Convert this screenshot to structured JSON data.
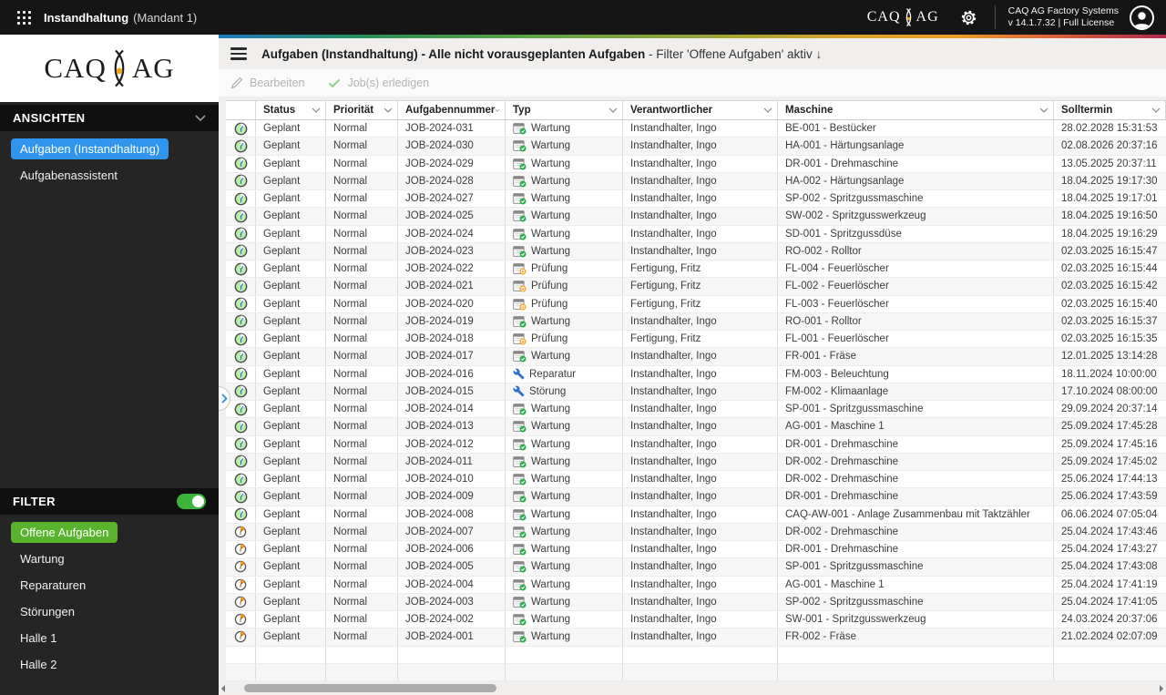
{
  "topbar": {
    "app_title": "Instandhaltung",
    "tenant": "(Mandant 1)",
    "brand_left": "CAQ",
    "brand_right": "AG",
    "product_name": "CAQ AG Factory Systems",
    "version_line": "v 14.1.7.32  |  Full License"
  },
  "sidebar": {
    "views_header": "ANSICHTEN",
    "views": [
      {
        "label": "Aufgaben (Instandhaltung)",
        "selected": true
      },
      {
        "label": "Aufgabenassistent",
        "selected": false
      }
    ],
    "filter_header": "FILTER",
    "filter_toggle_on": true,
    "filters": [
      {
        "label": "Offene Aufgaben",
        "selected": true
      },
      {
        "label": "Wartung",
        "selected": false
      },
      {
        "label": "Reparaturen",
        "selected": false
      },
      {
        "label": "Störungen",
        "selected": false
      },
      {
        "label": "Halle 1",
        "selected": false
      },
      {
        "label": "Halle 2",
        "selected": false
      }
    ]
  },
  "main": {
    "title_bold": "Aufgaben (Instandhaltung) - Alle nicht vorausgeplanten Aufgaben",
    "title_suffix": " - Filter 'Offene Aufgaben' aktiv ↓",
    "toolbar": {
      "edit_label": "Bearbeiten",
      "complete_label": "Job(s) erledigen"
    }
  },
  "table": {
    "columns": [
      "Status",
      "Priorität",
      "Aufgabennummer",
      "Typ",
      "Verantwortlicher",
      "Maschine",
      "Solltermin"
    ],
    "rows": [
      {
        "status_icon": "clock-green",
        "status": "Geplant",
        "priority": "Normal",
        "job": "JOB-2024-031",
        "type_icon": "wartung",
        "type": "Wartung",
        "responsible": "Instandhalter, Ingo",
        "machine": "BE-001 - Bestücker",
        "due": "28.02.2028 15:31:53"
      },
      {
        "status_icon": "clock-green",
        "status": "Geplant",
        "priority": "Normal",
        "job": "JOB-2024-030",
        "type_icon": "wartung",
        "type": "Wartung",
        "responsible": "Instandhalter, Ingo",
        "machine": "HA-001 - Härtungsanlage",
        "due": "02.08.2026 20:37:16"
      },
      {
        "status_icon": "clock-green",
        "status": "Geplant",
        "priority": "Normal",
        "job": "JOB-2024-029",
        "type_icon": "wartung",
        "type": "Wartung",
        "responsible": "Instandhalter, Ingo",
        "machine": "DR-001 - Drehmaschine",
        "due": "13.05.2025 20:37:11"
      },
      {
        "status_icon": "clock-green",
        "status": "Geplant",
        "priority": "Normal",
        "job": "JOB-2024-028",
        "type_icon": "wartung",
        "type": "Wartung",
        "responsible": "Instandhalter, Ingo",
        "machine": "HA-002 - Härtungsanlage",
        "due": "18.04.2025 19:17:30"
      },
      {
        "status_icon": "clock-green",
        "status": "Geplant",
        "priority": "Normal",
        "job": "JOB-2024-027",
        "type_icon": "wartung",
        "type": "Wartung",
        "responsible": "Instandhalter, Ingo",
        "machine": "SP-002 - Spritzgussmaschine",
        "due": "18.04.2025 19:17:01"
      },
      {
        "status_icon": "clock-green",
        "status": "Geplant",
        "priority": "Normal",
        "job": "JOB-2024-025",
        "type_icon": "wartung",
        "type": "Wartung",
        "responsible": "Instandhalter, Ingo",
        "machine": "SW-002 - Spritzgusswerkzeug",
        "due": "18.04.2025 19:16:50"
      },
      {
        "status_icon": "clock-green",
        "status": "Geplant",
        "priority": "Normal",
        "job": "JOB-2024-024",
        "type_icon": "wartung",
        "type": "Wartung",
        "responsible": "Instandhalter, Ingo",
        "machine": "SD-001 - Spritzgussdüse",
        "due": "18.04.2025 19:16:29"
      },
      {
        "status_icon": "clock-green",
        "status": "Geplant",
        "priority": "Normal",
        "job": "JOB-2024-023",
        "type_icon": "wartung",
        "type": "Wartung",
        "responsible": "Instandhalter, Ingo",
        "machine": "RO-002 - Rolltor",
        "due": "02.03.2025 16:15:47"
      },
      {
        "status_icon": "clock-green",
        "status": "Geplant",
        "priority": "Normal",
        "job": "JOB-2024-022",
        "type_icon": "pruefung",
        "type": "Prüfung",
        "responsible": "Fertigung, Fritz",
        "machine": "FL-004 - Feuerlöscher",
        "due": "02.03.2025 16:15:44"
      },
      {
        "status_icon": "clock-green",
        "status": "Geplant",
        "priority": "Normal",
        "job": "JOB-2024-021",
        "type_icon": "pruefung",
        "type": "Prüfung",
        "responsible": "Fertigung, Fritz",
        "machine": "FL-002 - Feuerlöscher",
        "due": "02.03.2025 16:15:42"
      },
      {
        "status_icon": "clock-green",
        "status": "Geplant",
        "priority": "Normal",
        "job": "JOB-2024-020",
        "type_icon": "pruefung",
        "type": "Prüfung",
        "responsible": "Fertigung, Fritz",
        "machine": "FL-003 - Feuerlöscher",
        "due": "02.03.2025 16:15:40"
      },
      {
        "status_icon": "clock-green",
        "status": "Geplant",
        "priority": "Normal",
        "job": "JOB-2024-019",
        "type_icon": "wartung",
        "type": "Wartung",
        "responsible": "Instandhalter, Ingo",
        "machine": "RO-001 - Rolltor",
        "due": "02.03.2025 16:15:37"
      },
      {
        "status_icon": "clock-green",
        "status": "Geplant",
        "priority": "Normal",
        "job": "JOB-2024-018",
        "type_icon": "pruefung",
        "type": "Prüfung",
        "responsible": "Fertigung, Fritz",
        "machine": "FL-001 - Feuerlöscher",
        "due": "02.03.2025 16:15:35"
      },
      {
        "status_icon": "clock-green",
        "status": "Geplant",
        "priority": "Normal",
        "job": "JOB-2024-017",
        "type_icon": "wartung",
        "type": "Wartung",
        "responsible": "Instandhalter, Ingo",
        "machine": "FR-001 - Fräse",
        "due": "12.01.2025 13:14:28"
      },
      {
        "status_icon": "clock-green",
        "status": "Geplant",
        "priority": "Normal",
        "job": "JOB-2024-016",
        "type_icon": "reparatur",
        "type": "Reparatur",
        "responsible": "Instandhalter, Ingo",
        "machine": "FM-003 - Beleuchtung",
        "due": "18.11.2024 10:00:00"
      },
      {
        "status_icon": "clock-green",
        "status": "Geplant",
        "priority": "Normal",
        "job": "JOB-2024-015",
        "type_icon": "stoerung",
        "type": "Störung",
        "responsible": "Instandhalter, Ingo",
        "machine": "FM-002 - Klimaanlage",
        "due": "17.10.2024 08:00:00"
      },
      {
        "status_icon": "clock-green",
        "status": "Geplant",
        "priority": "Normal",
        "job": "JOB-2024-014",
        "type_icon": "wartung",
        "type": "Wartung",
        "responsible": "Instandhalter, Ingo",
        "machine": "SP-001 - Spritzgussmaschine",
        "due": "29.09.2024 20:37:14"
      },
      {
        "status_icon": "clock-green",
        "status": "Geplant",
        "priority": "Normal",
        "job": "JOB-2024-013",
        "type_icon": "wartung",
        "type": "Wartung",
        "responsible": "Instandhalter, Ingo",
        "machine": "AG-001 - Maschine 1",
        "due": "25.09.2024 17:45:28"
      },
      {
        "status_icon": "clock-green",
        "status": "Geplant",
        "priority": "Normal",
        "job": "JOB-2024-012",
        "type_icon": "wartung",
        "type": "Wartung",
        "responsible": "Instandhalter, Ingo",
        "machine": "DR-001 - Drehmaschine",
        "due": "25.09.2024 17:45:16"
      },
      {
        "status_icon": "clock-green",
        "status": "Geplant",
        "priority": "Normal",
        "job": "JOB-2024-011",
        "type_icon": "wartung",
        "type": "Wartung",
        "responsible": "Instandhalter, Ingo",
        "machine": "DR-002 - Drehmaschine",
        "due": "25.09.2024 17:45:02"
      },
      {
        "status_icon": "clock-green",
        "status": "Geplant",
        "priority": "Normal",
        "job": "JOB-2024-010",
        "type_icon": "wartung",
        "type": "Wartung",
        "responsible": "Instandhalter, Ingo",
        "machine": "DR-002 - Drehmaschine",
        "due": "25.06.2024 17:44:13"
      },
      {
        "status_icon": "clock-green",
        "status": "Geplant",
        "priority": "Normal",
        "job": "JOB-2024-009",
        "type_icon": "wartung",
        "type": "Wartung",
        "responsible": "Instandhalter, Ingo",
        "machine": "DR-001 - Drehmaschine",
        "due": "25.06.2024 17:43:59"
      },
      {
        "status_icon": "clock-green",
        "status": "Geplant",
        "priority": "Normal",
        "job": "JOB-2024-008",
        "type_icon": "wartung",
        "type": "Wartung",
        "responsible": "Instandhalter, Ingo",
        "machine": "CAQ-AW-001 - Anlage Zusammenbau mit Taktzähler",
        "due": "06.06.2024 07:05:04"
      },
      {
        "status_icon": "clock-orange",
        "status": "Geplant",
        "priority": "Normal",
        "job": "JOB-2024-007",
        "type_icon": "wartung",
        "type": "Wartung",
        "responsible": "Instandhalter, Ingo",
        "machine": "DR-002 - Drehmaschine",
        "due": "25.04.2024 17:43:46"
      },
      {
        "status_icon": "clock-orange",
        "status": "Geplant",
        "priority": "Normal",
        "job": "JOB-2024-006",
        "type_icon": "wartung",
        "type": "Wartung",
        "responsible": "Instandhalter, Ingo",
        "machine": "DR-001 - Drehmaschine",
        "due": "25.04.2024 17:43:27"
      },
      {
        "status_icon": "clock-orange",
        "status": "Geplant",
        "priority": "Normal",
        "job": "JOB-2024-005",
        "type_icon": "wartung",
        "type": "Wartung",
        "responsible": "Instandhalter, Ingo",
        "machine": "SP-001 - Spritzgussmaschine",
        "due": "25.04.2024 17:43:08"
      },
      {
        "status_icon": "clock-orange",
        "status": "Geplant",
        "priority": "Normal",
        "job": "JOB-2024-004",
        "type_icon": "wartung",
        "type": "Wartung",
        "responsible": "Instandhalter, Ingo",
        "machine": "AG-001 - Maschine 1",
        "due": "25.04.2024 17:41:19"
      },
      {
        "status_icon": "clock-orange",
        "status": "Geplant",
        "priority": "Normal",
        "job": "JOB-2024-003",
        "type_icon": "wartung",
        "type": "Wartung",
        "responsible": "Instandhalter, Ingo",
        "machine": "SP-002 - Spritzgussmaschine",
        "due": "25.04.2024 17:41:05"
      },
      {
        "status_icon": "clock-orange",
        "status": "Geplant",
        "priority": "Normal",
        "job": "JOB-2024-002",
        "type_icon": "wartung",
        "type": "Wartung",
        "responsible": "Instandhalter, Ingo",
        "machine": "SW-001 - Spritzgusswerkzeug",
        "due": "24.03.2024 20:37:06"
      },
      {
        "status_icon": "clock-orange",
        "status": "Geplant",
        "priority": "Normal",
        "job": "JOB-2024-001",
        "type_icon": "wartung",
        "type": "Wartung",
        "responsible": "Instandhalter, Ingo",
        "machine": "FR-002 - Fräse",
        "due": "21.02.2024 02:07:09"
      }
    ]
  },
  "colors": {
    "accent_blue": "#3095ee",
    "accent_green": "#5ab32c",
    "toggle_green": "#3cb43c",
    "status_clock_green": "#b6efa8",
    "status_clock_orange": "#f2991f",
    "type_check_green": "#2eac4f",
    "type_badge_orange": "#f6a21d",
    "wrench_blue": "#2e6fd0"
  }
}
